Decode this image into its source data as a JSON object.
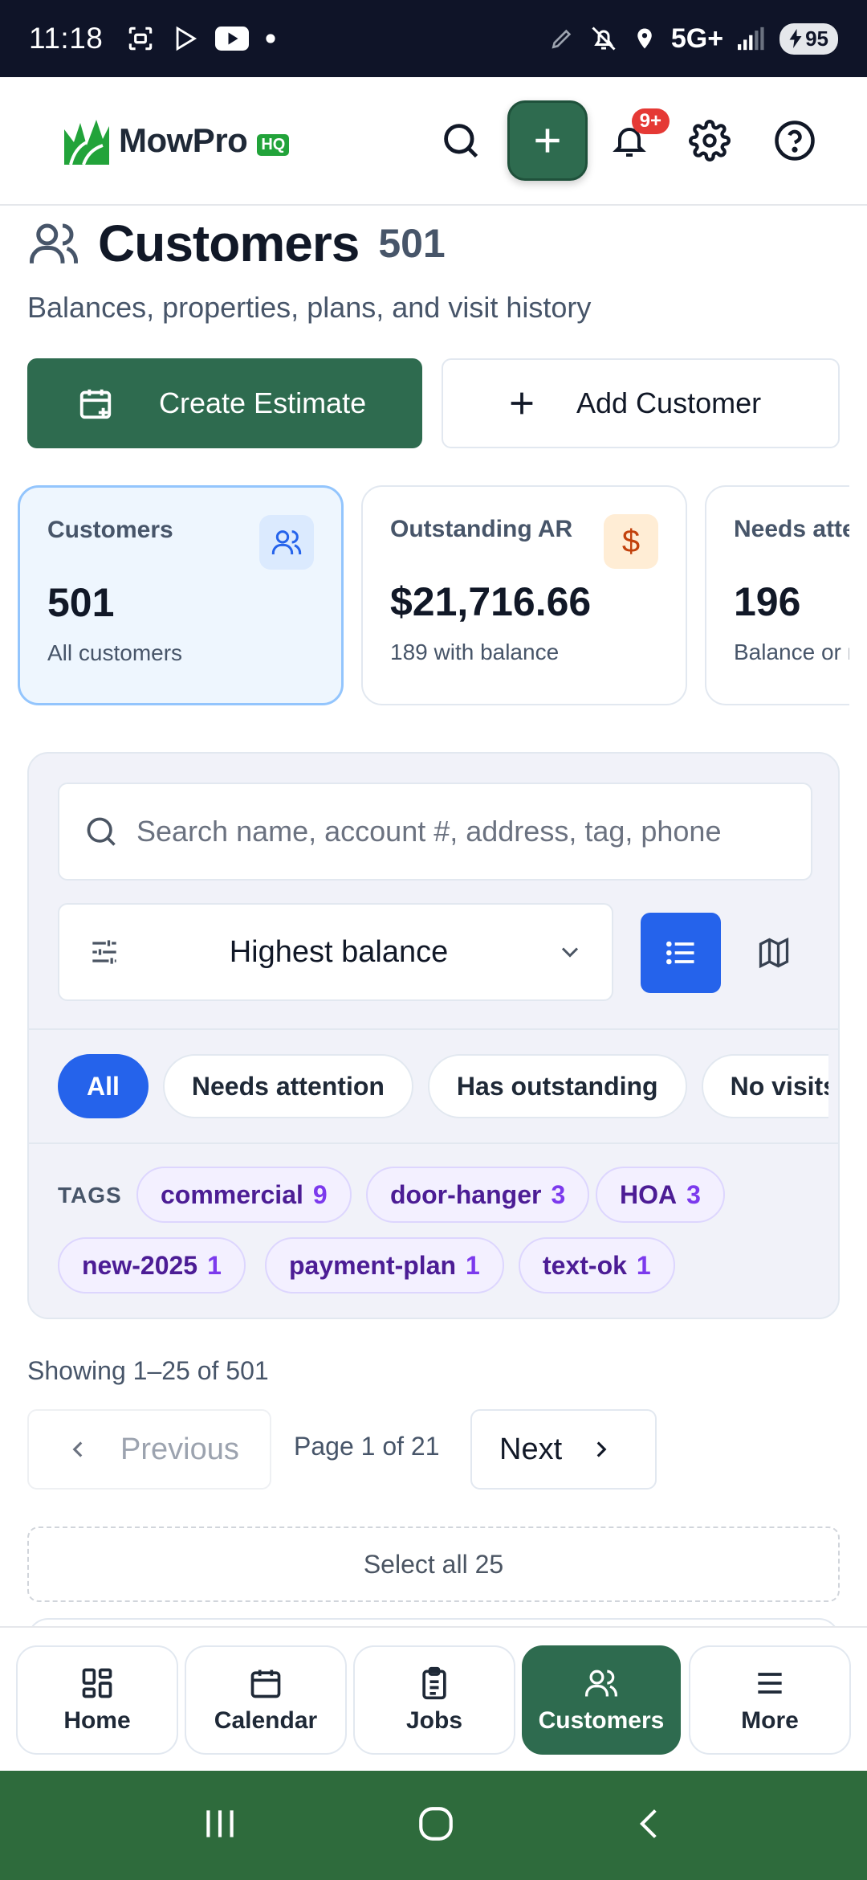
{
  "status_bar": {
    "time": "11:18",
    "network": "5G+",
    "battery": "95"
  },
  "header": {
    "logo_text": "MowPro",
    "logo_badge": "HQ",
    "notification_count": "9+",
    "icons": [
      "search-icon",
      "plus-icon",
      "bell-icon",
      "gear-icon",
      "help-icon"
    ]
  },
  "page": {
    "title": "Customers",
    "count": "501",
    "subtitle": "Balances, properties, plans, and visit history"
  },
  "actions": {
    "create_estimate": "Create Estimate",
    "add_customer": "Add Customer"
  },
  "stats": [
    {
      "label": "Customers",
      "value": "501",
      "sub": "All customers",
      "icon": "users-icon"
    },
    {
      "label": "Outstanding AR",
      "value": "$21,716.66",
      "sub": "189 with balance",
      "icon": "dollar-icon",
      "icon_glyph": "$"
    },
    {
      "label": "Needs attention",
      "value": "196",
      "sub": "Balance or no visits"
    }
  ],
  "filters": {
    "search_placeholder": "Search name, account #, address, tag, phone",
    "sort_value": "Highest balance",
    "chips": [
      "All",
      "Needs attention",
      "Has outstanding",
      "No visits"
    ],
    "active_chip": "All",
    "tags_label": "TAGS",
    "tags": [
      {
        "name": "commercial",
        "count": "9"
      },
      {
        "name": "door-hanger",
        "count": "3"
      },
      {
        "name": "HOA",
        "count": "3"
      },
      {
        "name": "new-2025",
        "count": "1"
      },
      {
        "name": "payment-plan",
        "count": "1"
      },
      {
        "name": "text-ok",
        "count": "1"
      }
    ]
  },
  "pagination": {
    "showing": "Showing 1–25 of 501",
    "previous": "Previous",
    "page_info": "Page 1 of 21",
    "next": "Next",
    "select_all": "Select all 25"
  },
  "bottom_nav": [
    {
      "label": "Home",
      "icon": "grid-icon"
    },
    {
      "label": "Calendar",
      "icon": "calendar-icon"
    },
    {
      "label": "Jobs",
      "icon": "clipboard-icon"
    },
    {
      "label": "Customers",
      "icon": "users-icon",
      "active": true
    },
    {
      "label": "More",
      "icon": "menu-icon"
    }
  ],
  "colors": {
    "brand_green": "#2e6b4f",
    "accent_blue": "#2563eb",
    "tag_purple": "#4c1d95",
    "badge_red": "#e53935",
    "system_nav_green": "#2e6b3c"
  }
}
